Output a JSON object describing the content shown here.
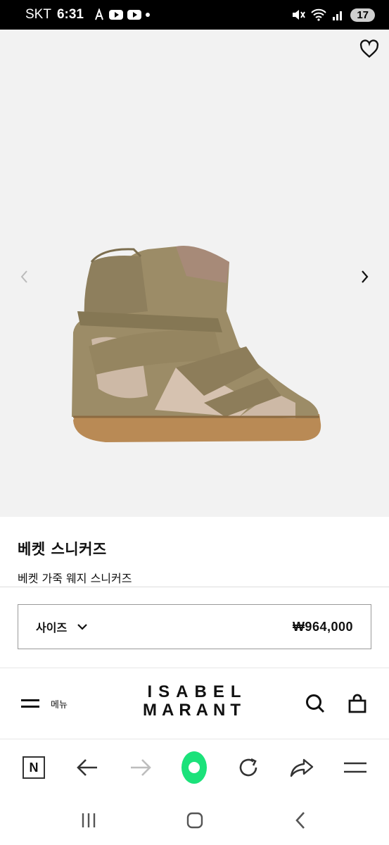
{
  "status_bar": {
    "carrier": "SKT",
    "time": "6:31",
    "notification_count": "17"
  },
  "product": {
    "title": "베켓 스니커즈",
    "subtitle": "베켓 가죽 웨지 스니커즈",
    "image_icon": "product-photo"
  },
  "purchase": {
    "size_label": "사이즈",
    "price": "₩964,000"
  },
  "site_nav": {
    "menu_label": "메뉴",
    "logo_line1": "ISABEL",
    "logo_line2": "MARANT"
  },
  "browser_toolbar": {
    "n_label": "N",
    "accent_color": "#1be27a"
  }
}
